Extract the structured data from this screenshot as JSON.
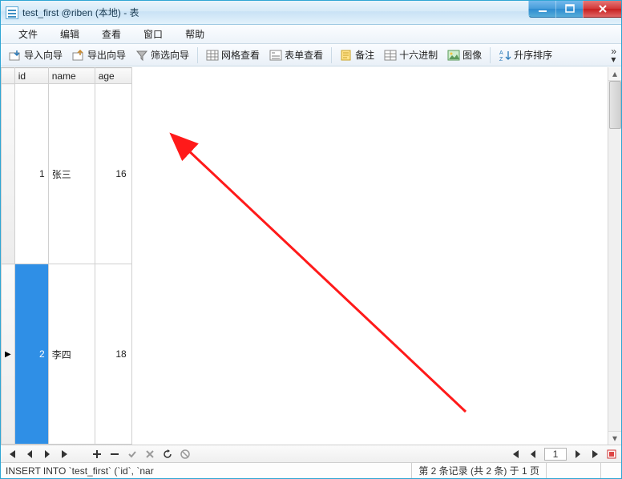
{
  "window": {
    "title": "test_first @riben (本地) - 表"
  },
  "menu": {
    "file": "文件",
    "edit": "编辑",
    "view": "查看",
    "window": "窗口",
    "help": "帮助"
  },
  "toolbar": {
    "import_wizard": "导入向导",
    "export_wizard": "导出向导",
    "filter_wizard": "筛选向导",
    "grid_view": "网格查看",
    "form_view": "表单查看",
    "memo": "备注",
    "hex": "十六进制",
    "image": "图像",
    "sort_asc": "升序排序"
  },
  "table": {
    "headers": {
      "id": "id",
      "name": "name",
      "age": "age"
    },
    "rows": [
      {
        "id": "1",
        "name": "张三",
        "age": "16",
        "current": false
      },
      {
        "id": "2",
        "name": "李四",
        "age": "18",
        "current": true
      }
    ]
  },
  "nav": {
    "page_value": "1"
  },
  "status": {
    "sql": "INSERT INTO `test_first` (`id`, `nar",
    "record": "第 2 条记录 (共 2 条) 于 1 页"
  }
}
